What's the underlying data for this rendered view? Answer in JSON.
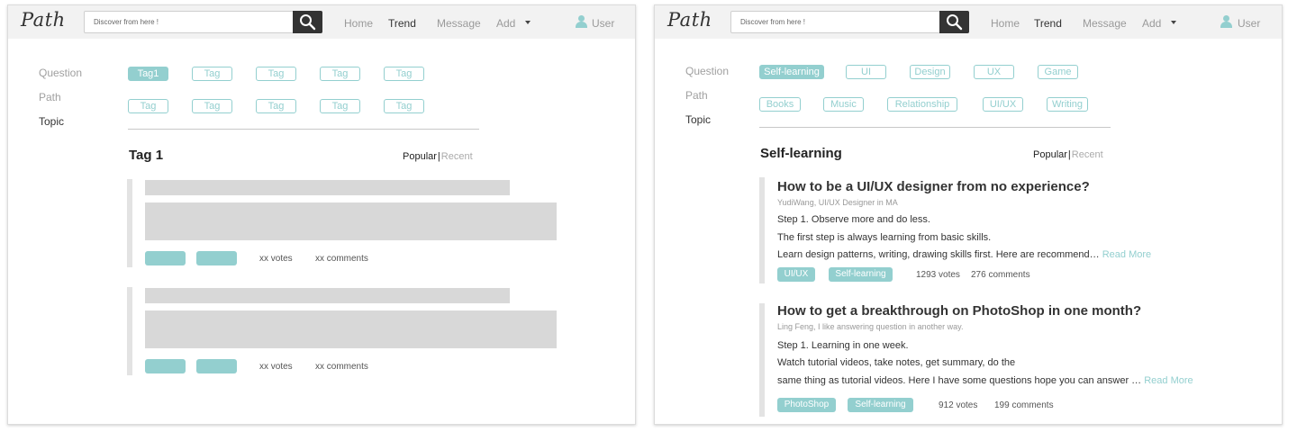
{
  "left": {
    "logo": "Path",
    "search_placeholder": "Discover from here !",
    "nav": [
      "Home",
      "Trend",
      "Message",
      "Add"
    ],
    "user_label": "User",
    "side": [
      "Question",
      "Path",
      "Topic"
    ],
    "tags_row1": [
      "Tag1",
      "Tag",
      "Tag",
      "Tag",
      "Tag"
    ],
    "tags_row2": [
      "Tag",
      "Tag",
      "Tag",
      "Tag",
      "Tag"
    ],
    "section_title": "Tag 1",
    "sort": {
      "popular": "Popular",
      "separator": "|",
      "recent": "Recent"
    },
    "posts": [
      {
        "votes": "xx votes",
        "comments": "xx comments"
      },
      {
        "votes": "xx votes",
        "comments": "xx comments"
      }
    ]
  },
  "right": {
    "logo": "Path",
    "search_placeholder": "Discover from here !",
    "nav": [
      "Home",
      "Trend",
      "Message",
      "Add"
    ],
    "user_label": "User",
    "side": [
      "Question",
      "Path",
      "Topic"
    ],
    "tags_row1": [
      "Self-learning",
      "UI",
      "Design",
      "UX",
      "Game"
    ],
    "tags_row2": [
      "Books",
      "Music",
      "Relationship",
      "UI/UX",
      "Writing"
    ],
    "section_title": "Self-learning",
    "sort": {
      "popular": "Popular",
      "separator": "|",
      "recent": "Recent"
    },
    "posts": [
      {
        "title": "How to be a UI/UX designer from no experience?",
        "author": "YudiWang, UI/UX Designer in MA",
        "lines": [
          "Step 1. Observe more and do less.",
          "The first step is always learning from basic skills.",
          "Learn design patterns, writing, drawing skills first. Here are recommend…"
        ],
        "read_more": "Read More",
        "tags": [
          "UI/UX",
          "Self-learning"
        ],
        "votes": "1293 votes",
        "comments": "276 comments"
      },
      {
        "title": "How to get a breakthrough on PhotoShop in one month?",
        "author": "Ling Feng, I like answering question in another way.",
        "lines": [
          "Step 1. Learning in one week.",
          "Watch tutorial videos, take notes, get summary, do the",
          "same thing as tutorial videos. Here I have some questions hope you can answer …"
        ],
        "read_more": "Read More",
        "tags": [
          "PhotoShop",
          "Self-learning"
        ],
        "votes": "912 votes",
        "comments": "199 comments"
      }
    ]
  },
  "colors": {
    "accent": "#93cfcf",
    "dark": "#333333",
    "placeholder": "#d8d8d8"
  },
  "icons": {
    "search": "search-icon",
    "user": "user-icon",
    "add_caret": "caret-down-icon"
  }
}
